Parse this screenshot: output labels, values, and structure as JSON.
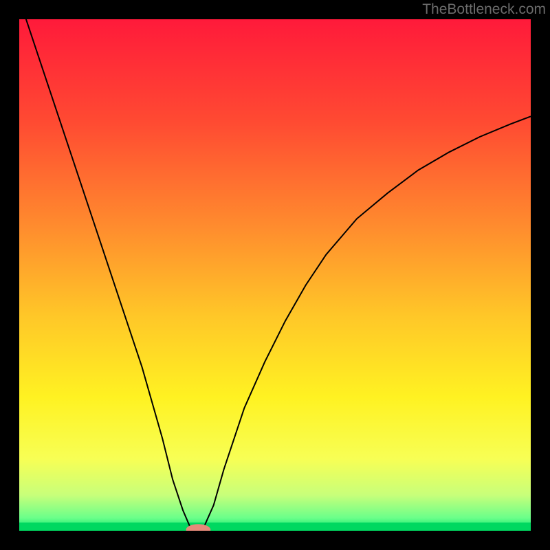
{
  "watermark": "TheBottleneck.com",
  "chart_data": {
    "type": "line",
    "title": "",
    "xlabel": "",
    "ylabel": "",
    "xlim": [
      0,
      100
    ],
    "ylim": [
      0,
      100
    ],
    "background_gradient": {
      "stops": [
        {
          "offset": 0.0,
          "color": "#ff1a3a"
        },
        {
          "offset": 0.2,
          "color": "#ff4a32"
        },
        {
          "offset": 0.4,
          "color": "#ff8a2e"
        },
        {
          "offset": 0.58,
          "color": "#ffc728"
        },
        {
          "offset": 0.74,
          "color": "#fff222"
        },
        {
          "offset": 0.86,
          "color": "#f7ff55"
        },
        {
          "offset": 0.93,
          "color": "#c8ff7a"
        },
        {
          "offset": 0.975,
          "color": "#6aff8a"
        },
        {
          "offset": 1.0,
          "color": "#00e26a"
        }
      ]
    },
    "series": [
      {
        "name": "bottleneck_curve",
        "x": [
          0,
          4,
          8,
          12,
          16,
          20,
          24,
          28,
          30,
          32,
          33.5,
          34.5,
          35.5,
          36,
          38,
          40,
          44,
          48,
          52,
          56,
          60,
          66,
          72,
          78,
          84,
          90,
          96,
          100
        ],
        "y": [
          104,
          92,
          80,
          68,
          56,
          44,
          32,
          18,
          10,
          4,
          0.5,
          0,
          0,
          0.5,
          5,
          12,
          24,
          33,
          41,
          48,
          54,
          61,
          66,
          70.5,
          74,
          77,
          79.5,
          81
        ]
      }
    ],
    "marker": {
      "x": 35,
      "y": 0.2,
      "color": "#e58a7a",
      "rx": 2.4,
      "ry": 1.1
    },
    "green_strip": {
      "y": 0,
      "height": 1.6,
      "color": "#00d860"
    }
  }
}
